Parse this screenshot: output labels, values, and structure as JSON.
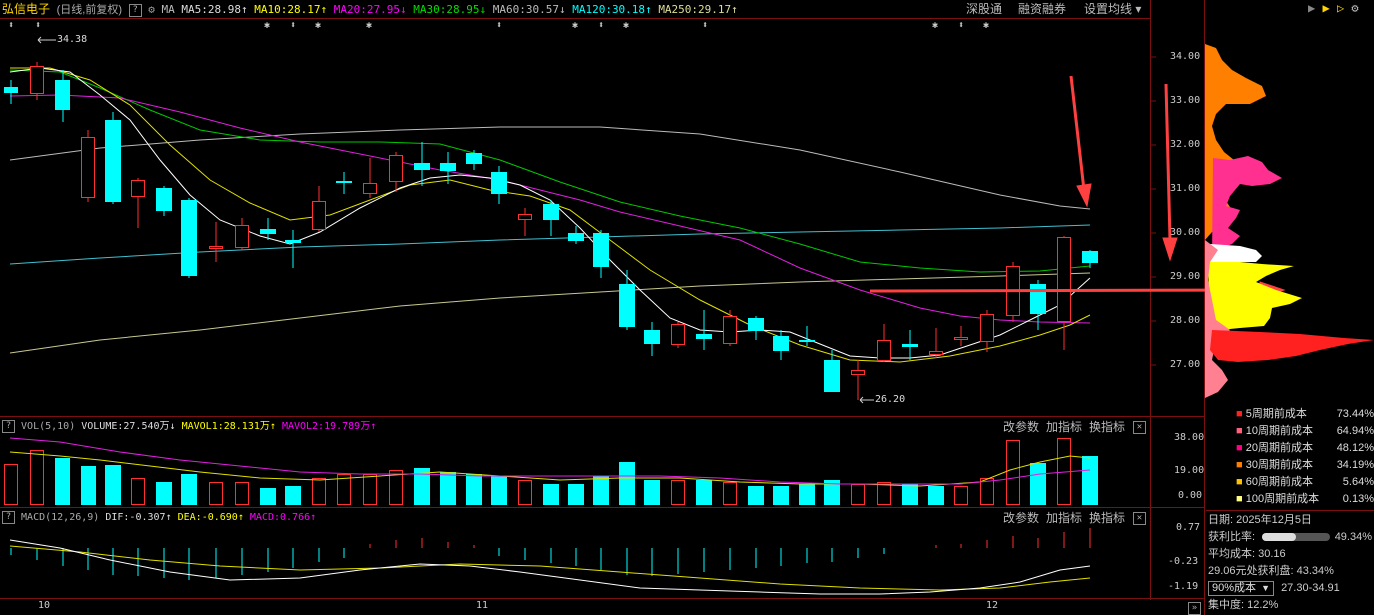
{
  "header": {
    "stock_name": "弘信电子",
    "period": "(日线,前复权)",
    "help": "?",
    "ma_label": "MA",
    "ma5": "MA5:28.98",
    "ma10": "MA10:28.17",
    "ma20": "MA20:27.95",
    "ma30": "MA30:28.95",
    "ma60": "MA60:30.57",
    "ma120": "MA120:30.18",
    "ma250": "MA250:29.17",
    "arrow_up": "↑",
    "arrow_down": "↓",
    "menu_sgt": "深股通",
    "menu_rzrq": "融资融券",
    "menu_setma": "设置均线"
  },
  "main_chart": {
    "high_label": "34.38",
    "low_label": "26.20",
    "price_ticks": [
      "34.00",
      "33.00",
      "32.00",
      "31.00",
      "30.00",
      "29.00",
      "28.00",
      "27.00"
    ]
  },
  "vol_panel": {
    "title": "VOL(5,10)",
    "volume": "VOLUME:27.540万",
    "mavol1": "MAVOL1:28.131万",
    "mavol2": "MAVOL2:19.789万",
    "btn_params": "改参数",
    "btn_add": "加指标",
    "btn_swap": "换指标",
    "ticks": [
      "38.00",
      "19.00",
      "0.00"
    ]
  },
  "macd_panel": {
    "title": "MACD(12,26,9)",
    "dif": "DIF:-0.307",
    "dea": "DEA:-0.690",
    "macd": "MACD:0.766",
    "btn_params": "改参数",
    "btn_add": "加指标",
    "btn_swap": "换指标",
    "ticks": [
      "0.77",
      "-0.23",
      "-1.19"
    ]
  },
  "x_axis": {
    "months": [
      "10",
      "11",
      "12"
    ]
  },
  "right_panel": {
    "legend": [
      {
        "label": "5周期前成本",
        "value": "73.44%",
        "color": "#ff2020"
      },
      {
        "label": "10周期前成本",
        "value": "64.94%",
        "color": "#ff6080"
      },
      {
        "label": "20周期前成本",
        "value": "48.12%",
        "color": "#ff0080"
      },
      {
        "label": "30周期前成本",
        "value": "34.19%",
        "color": "#ff8000"
      },
      {
        "label": "60周期前成本",
        "value": "5.64%",
        "color": "#ffc000"
      },
      {
        "label": "100周期前成本",
        "value": "0.13%",
        "color": "#ffff80"
      }
    ],
    "date": "日期: 2025年12月5日",
    "profit_ratio_label": "获利比率:",
    "profit_ratio": "49.34%",
    "profit_ratio_fraction": 0.4934,
    "avg_cost": "平均成本: 30.16",
    "profit_at": "29.06元处获利盘: 43.34%",
    "cost_select": "90%成本",
    "cost_range": "27.30-34.91",
    "concentration": "集中度: 12.2%"
  }
}
